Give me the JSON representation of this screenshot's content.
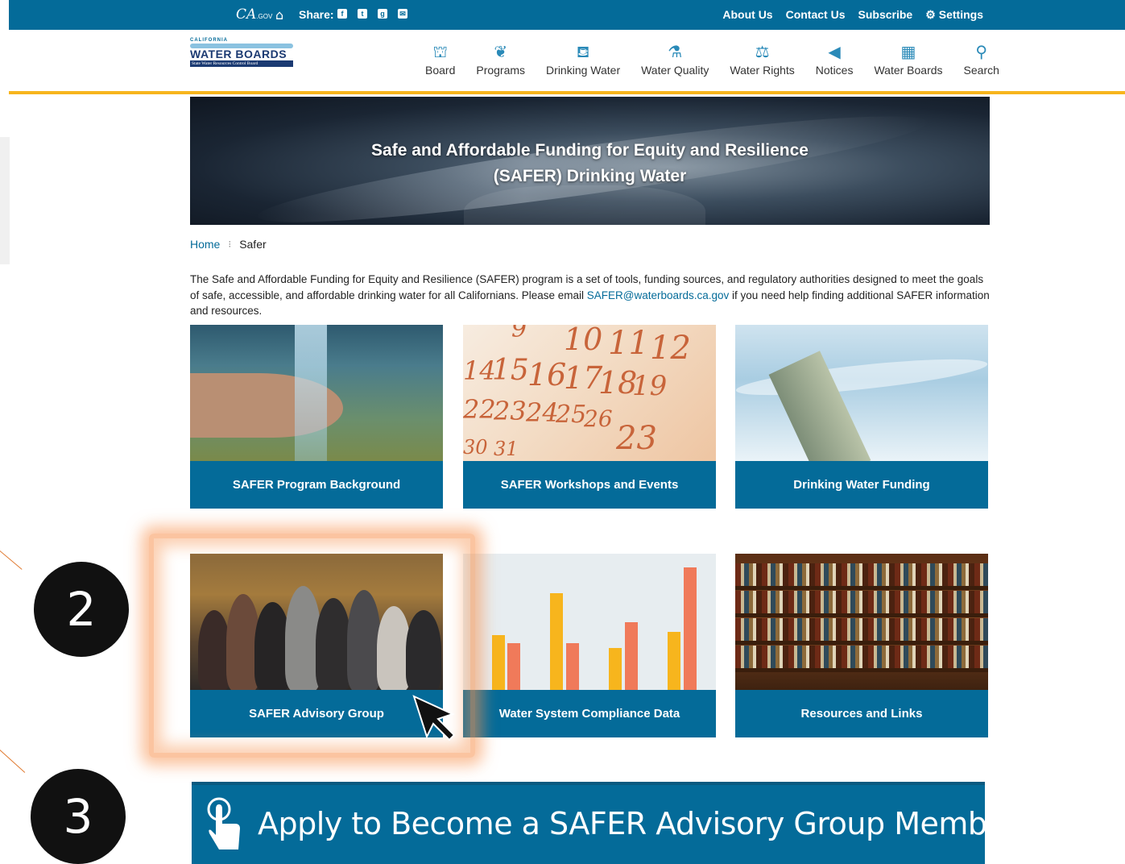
{
  "utility_bar": {
    "ca_logo": "CA",
    "ca_logo_suffix": ".GOV",
    "share_label": "Share:",
    "share_icons": [
      "f",
      "t",
      "g",
      "✉"
    ],
    "links": [
      "About Us",
      "Contact Us",
      "Subscribe",
      "Settings"
    ]
  },
  "logo": {
    "top_line": "CALIFORNIA",
    "main": "WATER BOARDS",
    "sub": "State Water Resources Control Board"
  },
  "nav": {
    "items": [
      {
        "label": "Board",
        "icon": "org-chart-icon"
      },
      {
        "label": "Programs",
        "icon": "leaf-icon"
      },
      {
        "label": "Drinking Water",
        "icon": "cup-icon"
      },
      {
        "label": "Water Quality",
        "icon": "flask-icon"
      },
      {
        "label": "Water Rights",
        "icon": "scales-icon"
      },
      {
        "label": "Notices",
        "icon": "megaphone-icon"
      },
      {
        "label": "Water Boards",
        "icon": "buildings-icon"
      },
      {
        "label": "Search",
        "icon": "search-icon"
      }
    ]
  },
  "hero": {
    "line1": "Safe and Affordable Funding for Equity and Resilience",
    "line2": "(SAFER) Drinking Water"
  },
  "breadcrumb": {
    "home": "Home",
    "separator": "⁝",
    "current": "Safer"
  },
  "intro": {
    "text_before": "The Safe and Affordable Funding for Equity and Resilience (SAFER) program is a set of tools, funding sources, and regulatory authorities designed to meet the goals of safe, accessible, and affordable drinking water for all Californians. Please email ",
    "email": "SAFER@waterboards.ca.gov",
    "text_after": " if you need help finding additional SAFER information and resources."
  },
  "tiles": [
    {
      "label": "SAFER Program Background"
    },
    {
      "label": "SAFER Workshops and Events"
    },
    {
      "label": "Drinking Water Funding"
    },
    {
      "label": "SAFER Advisory Group"
    },
    {
      "label": "Water System Compliance Data"
    },
    {
      "label": "Resources and Links"
    }
  ],
  "calendar_numbers": [
    "9",
    "10",
    "11",
    "12",
    "14",
    "15",
    "16",
    "17",
    "18",
    "19",
    "22",
    "23",
    "24",
    "25",
    "26",
    "23",
    "30",
    "31"
  ],
  "steps": [
    "2",
    "3"
  ],
  "apply_banner": {
    "text": "Apply to Become a SAFER Advisory Group Member"
  },
  "colors": {
    "primary": "#046b99",
    "accent": "#f7b51d",
    "highlight": "#f79452"
  }
}
